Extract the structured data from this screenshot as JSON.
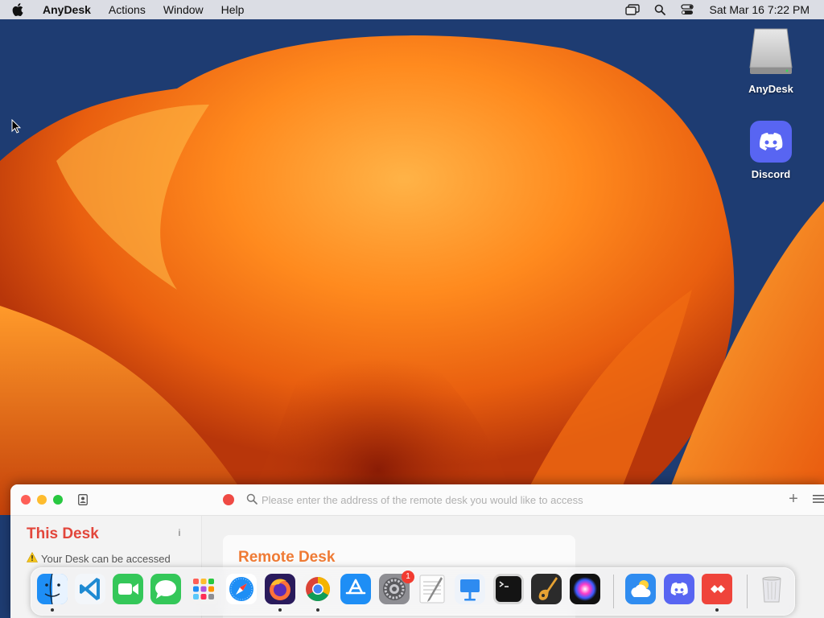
{
  "menubar": {
    "apple_icon": "apple-logo-icon",
    "app_name": "AnyDesk",
    "menus": [
      "Actions",
      "Window",
      "Help"
    ],
    "status_icons": [
      "screen-mirroring-icon",
      "spotlight-search-icon",
      "control-center-icon"
    ],
    "clock": "Sat Mar 16  7:22 PM"
  },
  "desktop": {
    "icons": [
      {
        "label": "AnyDesk",
        "icon": "external-drive-icon"
      },
      {
        "label": "Discord",
        "icon": "discord-icon"
      }
    ]
  },
  "window": {
    "search": {
      "placeholder": "Please enter the address of the remote desk you would like to access"
    },
    "plus_label": "+",
    "info_label": "i",
    "this_desk_title": "This Desk",
    "warning_text": "Your Desk can be accessed",
    "remote_desk_title": "Remote Desk",
    "status_color": "#ef4a44"
  },
  "dock": {
    "items": [
      {
        "name": "Finder",
        "icon": "finder-icon",
        "running": true
      },
      {
        "name": "Visual Studio Code",
        "icon": "vscode-icon",
        "running": false
      },
      {
        "name": "FaceTime",
        "icon": "facetime-icon",
        "running": false
      },
      {
        "name": "Messages",
        "icon": "messages-icon",
        "running": false
      },
      {
        "name": "Launchpad",
        "icon": "launchpad-icon",
        "running": false
      },
      {
        "name": "Safari",
        "icon": "safari-icon",
        "running": false
      },
      {
        "name": "Firefox",
        "icon": "firefox-icon",
        "running": true
      },
      {
        "name": "Chrome",
        "icon": "chrome-icon",
        "running": true
      },
      {
        "name": "App Store",
        "icon": "app-store-icon",
        "running": false
      },
      {
        "name": "System Settings",
        "icon": "system-settings-icon",
        "running": false,
        "badge": "1"
      },
      {
        "name": "TextEdit",
        "icon": "textedit-icon",
        "running": false
      },
      {
        "name": "Keynote",
        "icon": "keynote-icon",
        "running": false
      },
      {
        "name": "Terminal",
        "icon": "terminal-icon",
        "running": false
      },
      {
        "name": "GarageBand",
        "icon": "garageband-icon",
        "running": false
      },
      {
        "name": "Siri",
        "icon": "siri-icon",
        "running": false
      },
      {
        "name": "Weather",
        "icon": "weather-icon",
        "running": false
      },
      {
        "name": "Discord",
        "icon": "discord-icon",
        "running": false
      },
      {
        "name": "AnyDesk",
        "icon": "anydesk-icon",
        "running": true
      },
      {
        "name": "Trash",
        "icon": "trash-icon",
        "running": false
      }
    ]
  }
}
